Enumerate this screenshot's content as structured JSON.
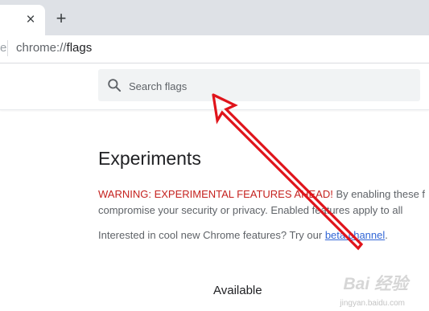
{
  "tab": {
    "close_glyph": "×"
  },
  "toolbar": {
    "newtab_glyph": "+",
    "omnibox_edge": "e",
    "url_scheme": "chrome://",
    "url_host": "flags"
  },
  "search": {
    "placeholder": "Search flags",
    "value": ""
  },
  "main": {
    "title": "Experiments",
    "warning_label": "WARNING: EXPERIMENTAL FEATURES AHEAD!",
    "warning_text_line1": " By enabling these f",
    "warning_text_line2": "compromise your security or privacy. Enabled features apply to all",
    "interest_text": "Interested in cool new Chrome features? Try our ",
    "beta_link": "beta channel",
    "interest_end": "."
  },
  "tabs": {
    "available": "Available"
  },
  "watermark": {
    "text": "Bai 经验",
    "sub": "jingyan.baidu.com"
  },
  "colors": {
    "warning": "#c5221f",
    "link": "#3367d6",
    "arrow": "#e0141b"
  },
  "icons": {
    "search": "search-icon",
    "close": "close-icon",
    "add": "plus-icon"
  }
}
